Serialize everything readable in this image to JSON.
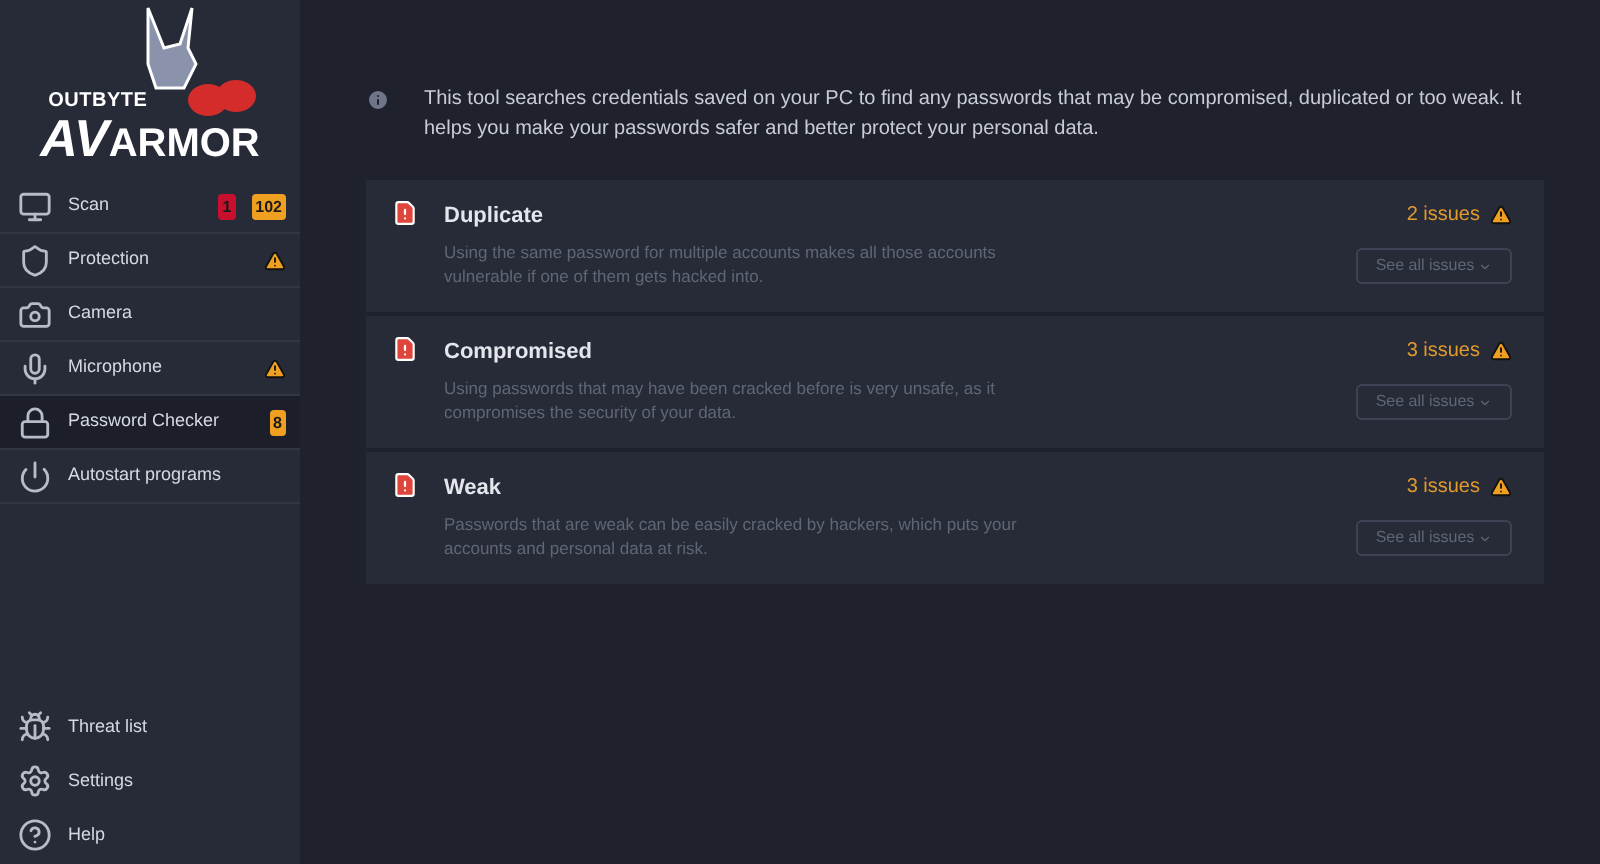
{
  "logo": {
    "top": "OUTBYTE",
    "main_a": "AV",
    "main_b": "ARMOR"
  },
  "sidebar": {
    "items": [
      {
        "kind": "scan",
        "label": "Scan",
        "selected": false,
        "warning": false,
        "badges": [
          {
            "text": "1",
            "color": "#c8102e"
          },
          {
            "text": "102",
            "color": "#f0a020"
          }
        ]
      },
      {
        "kind": "protection",
        "label": "Protection",
        "selected": false,
        "warning": true
      },
      {
        "kind": "camera",
        "label": "Camera",
        "selected": false,
        "warning": false
      },
      {
        "kind": "microphone",
        "label": "Microphone",
        "selected": false,
        "warning": true
      },
      {
        "kind": "password",
        "label": "Password Checker",
        "selected": true,
        "warning": false,
        "badges": [
          {
            "text": "8",
            "color": "#f0a020"
          }
        ]
      },
      {
        "kind": "autostart",
        "label": "Autostart programs",
        "selected": false,
        "warning": false
      }
    ],
    "bottom_items": [
      {
        "kind": "threats",
        "label": "Threat list"
      },
      {
        "kind": "settings",
        "label": "Settings"
      },
      {
        "kind": "help",
        "label": "Help"
      }
    ]
  },
  "info": "This tool searches credentials saved on your PC to find any passwords that may be compromised, duplicated or too weak. It helps you make your passwords safer and better protect your personal data.",
  "checks": [
    {
      "title": "Duplicate",
      "description": "Using the same password for multiple accounts makes all those accounts vulnerable if one of them gets hacked into.",
      "issues": "2 issues",
      "button": "See all issues"
    },
    {
      "title": "Compromised",
      "description": "Using passwords that may have been cracked before is very unsafe, as it compromises the security of your data.",
      "issues": "3 issues",
      "button": "See all issues"
    },
    {
      "title": "Weak",
      "description": "Passwords that are weak can be easily cracked by hackers, which puts your accounts and personal data at risk.",
      "issues": "3 issues",
      "button": "See all issues"
    }
  ]
}
